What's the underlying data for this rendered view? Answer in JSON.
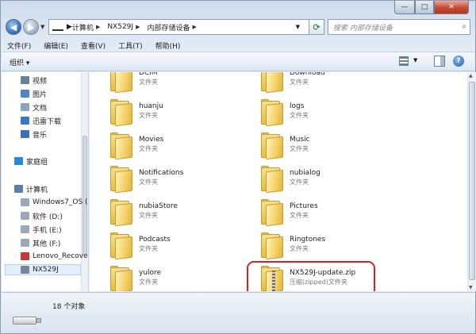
{
  "window": {
    "caption": {
      "minimize": "—",
      "maximize": "□",
      "close": "✕"
    }
  },
  "address": {
    "crumbs": [
      "计算机",
      "NX529J",
      "内部存储设备"
    ],
    "search_placeholder": "搜索 内部存储设备"
  },
  "menu": [
    "文件(F)",
    "编辑(E)",
    "查看(V)",
    "工具(T)",
    "帮助(H)"
  ],
  "toolbar": {
    "organize": "组织 ▾"
  },
  "nav": [
    {
      "label": "视频",
      "icon": "video-library-icon",
      "color": "#6b7f99"
    },
    {
      "label": "图片",
      "icon": "pictures-library-icon",
      "color": "#4f86c6"
    },
    {
      "label": "文档",
      "icon": "documents-library-icon",
      "color": "#8aa4c4"
    },
    {
      "label": "迅雷下载",
      "icon": "download-folder-icon",
      "color": "#3a78c9"
    },
    {
      "label": "音乐",
      "icon": "music-library-icon",
      "color": "#3d6fb8"
    },
    {
      "label": "家庭组",
      "icon": "homegroup-icon",
      "color": "#2b8ad6"
    },
    {
      "label": "计算机",
      "icon": "computer-icon",
      "color": "#5c7ea8"
    },
    {
      "label": "Windows7_OS (",
      "icon": "windows-drive-icon",
      "color": "#9aa8b8"
    },
    {
      "label": "软件 (D:)",
      "icon": "drive-d-icon",
      "color": "#9aa8b8"
    },
    {
      "label": "手机 (E:)",
      "icon": "drive-e-icon",
      "color": "#9aa8b8"
    },
    {
      "label": "其他 (F:)",
      "icon": "drive-f-icon",
      "color": "#9aa8b8"
    },
    {
      "label": "Lenovo_Recove",
      "icon": "lenovo-recovery-icon",
      "color": "#c23a3a"
    },
    {
      "label": "NX529J",
      "icon": "phone-device-icon",
      "color": "#7a8796"
    }
  ],
  "items": [
    {
      "name": "DCIM",
      "type": "文件夹"
    },
    {
      "name": "Download",
      "type": "文件夹"
    },
    {
      "name": "huanju",
      "type": "文件夹"
    },
    {
      "name": "logs",
      "type": "文件夹"
    },
    {
      "name": "Movies",
      "type": "文件夹"
    },
    {
      "name": "Music",
      "type": "文件夹"
    },
    {
      "name": "Notifications",
      "type": "文件夹"
    },
    {
      "name": "nubialog",
      "type": "文件夹"
    },
    {
      "name": "nubiaStore",
      "type": "文件夹"
    },
    {
      "name": "Pictures",
      "type": "文件夹"
    },
    {
      "name": "Podcasts",
      "type": "文件夹"
    },
    {
      "name": "Ringtones",
      "type": "文件夹"
    },
    {
      "name": "yulore",
      "type": "文件夹"
    },
    {
      "name": "NX529J-update.zip",
      "type": "压缩(zipped)文件夹"
    }
  ],
  "status": {
    "count": "18 个对象"
  },
  "colors": {
    "highlight": "#d8202c",
    "folder": "#f3d167"
  }
}
